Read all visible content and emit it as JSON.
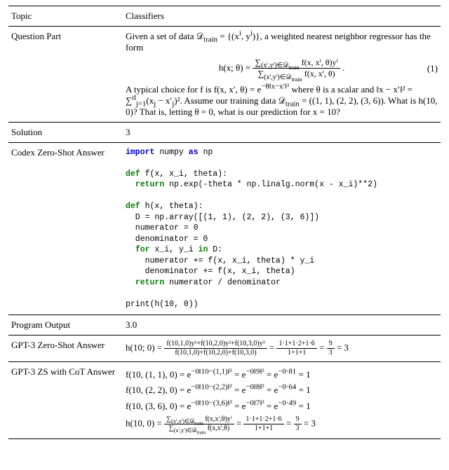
{
  "rows": {
    "topic": {
      "label": "Topic",
      "value": "Classifiers"
    },
    "question": {
      "label": "Question Part",
      "intro_a": "Given a set of data ",
      "intro_b": " = {(x",
      "intro_c": ", y",
      "intro_d": ")}, a weighted nearest neighbor regressor has the form",
      "eq_lhs": "h(x; θ) = ",
      "eq_num_sum": "∑",
      "eq_num_sub": "(xⁱ,yⁱ)∈𝒟",
      "eq_num_sub_train": "train",
      "eq_num_body": " f(x, xⁱ, θ)yⁱ",
      "eq_den_sum": "∑",
      "eq_den_sub": "(xⁱ,yⁱ)∈𝒟",
      "eq_den_sub_train": "train",
      "eq_den_body": " f(x, xⁱ, θ)",
      "eq_tail": ".",
      "eq_number": "(1)",
      "para2_a": "A typical choice for f is f(x, x′, θ) = e",
      "para2_exp": "−θ‖x−x′‖²",
      "para2_b": " where θ is a scalar and ‖x − x′‖² = ∑",
      "para2_sub": "j=1",
      "para2_sup": "d",
      "para2_c": "(x",
      "para2_c_sub": "j",
      "para2_d": " − x′",
      "para2_d_sub": "j",
      "para2_e": ")². Assume our training data 𝒟",
      "para2_train": "train",
      "para2_f": " = ((1, 1), (2, 2), (3, 6)). What is h(10, 0)? That is, letting θ = 0, what is our prediction for x = 10?",
      "dtrain_script": "𝒟",
      "dtrain_sub": "train"
    },
    "solution": {
      "label": "Solution",
      "value": "3"
    },
    "codex": {
      "label": "Codex Zero-Shot Answer",
      "code_lines": [
        {
          "t": "import",
          "cls": "imp",
          "rest": " numpy ",
          "t2": "as",
          "cls2": "imp",
          "rest2": " np"
        },
        {
          "blank": true
        },
        {
          "t": "def",
          "cls": "kw",
          "rest": " f(x, x_i, theta):"
        },
        {
          "indent": "  ",
          "t": "return",
          "cls": "kw",
          "rest": " np.exp(-theta * np.linalg.norm(x - x_i)**2)"
        },
        {
          "blank": true
        },
        {
          "t": "def",
          "cls": "kw",
          "rest": " h(x, theta):"
        },
        {
          "indent": "  ",
          "rest": "D = np.array([(1, 1), (2, 2), (3, 6)])"
        },
        {
          "indent": "  ",
          "rest": "numerator = 0"
        },
        {
          "indent": "  ",
          "rest": "denominator = 0"
        },
        {
          "indent": "  ",
          "t": "for",
          "cls": "kw",
          "rest": " x_i, y_i ",
          "t2": "in",
          "cls2": "kw",
          "rest2": " D:"
        },
        {
          "indent": "    ",
          "rest": "numerator += f(x, x_i, theta) * y_i"
        },
        {
          "indent": "    ",
          "rest": "denominator += f(x, x_i, theta)"
        },
        {
          "indent": "  ",
          "t": "return",
          "cls": "kw",
          "rest": " numerator / denominator"
        },
        {
          "blank": true
        },
        {
          "rest": "print(h(10, 0))"
        }
      ]
    },
    "output": {
      "label": "Program Output",
      "value": "3.0"
    },
    "gpt3zs": {
      "label": "GPT-3 Zero-Shot Answer",
      "lhs": "h(10; 0) = ",
      "frac1_num": "f(10,1,0)y¹+f(10,2,0)y²+f(10,3,0)y³",
      "frac1_den": "f(10,1,0)+f(10,2,0)+f(10,3,0)",
      "mid": " = ",
      "frac2_num": "1·1+1·2+1·6",
      "frac2_den": "1+1+1",
      "mid2": " = ",
      "frac3_num": "9",
      "frac3_den": "3",
      "tail": " = 3"
    },
    "gpt3cot": {
      "label": "GPT-3 ZS with CoT Answer",
      "line1_a": "f(10, (1, 1), 0) = e",
      "line1_exp1": "−0‖10−(1,1)‖²",
      "line1_b": " = e",
      "line1_exp2": "−0‖9‖²",
      "line1_c": " = e",
      "line1_exp3": "−0·81",
      "line1_d": " = 1",
      "line2_a": "f(10, (2, 2), 0) = e",
      "line2_exp1": "−0‖10−(2,2)‖²",
      "line2_b": " = e",
      "line2_exp2": "−0‖8‖²",
      "line2_c": " = e",
      "line2_exp3": "−0·64",
      "line2_d": " = 1",
      "line3_a": "f(10, (3, 6), 0) = e",
      "line3_exp1": "−0‖10−(3,6)‖²",
      "line3_b": " = e",
      "line3_exp2": "−0‖7‖²",
      "line3_c": " = e",
      "line3_exp3": "−0·49",
      "line3_d": " = 1",
      "line4_lhs": "h(10, 0) = ",
      "line4_num_a": "∑",
      "line4_num_sub": "(xⁱ,yⁱ)∈𝒟",
      "line4_train": "train",
      "line4_num_b": " f(x,xⁱ,θ)yⁱ",
      "line4_den_a": "∑",
      "line4_den_sub": "(xⁱ,yⁱ)∈𝒟",
      "line4_den_b": " f(x,xⁱ,θ)",
      "line4_mid": " = ",
      "line4_frac2_num": "1·1+1·2+1·6",
      "line4_frac2_den": "1+1+1",
      "line4_mid2": " = ",
      "line4_frac3_num": "9",
      "line4_frac3_den": "3",
      "line4_tail": " = 3"
    }
  }
}
